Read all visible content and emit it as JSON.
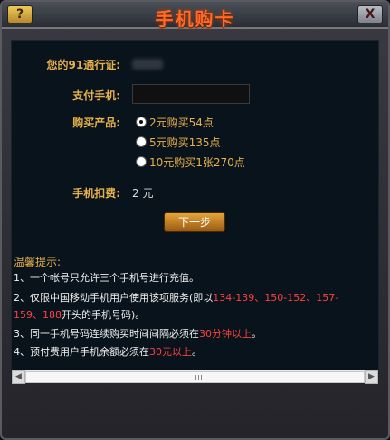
{
  "window": {
    "title": "手机购卡",
    "help_label": "?",
    "close_label": "X"
  },
  "form": {
    "account_label": "您的91通行证:",
    "phone_label": "支付手机:",
    "phone_value": "",
    "product_label": "购买产品:",
    "products": [
      {
        "label": "2元购买54点",
        "checked": true
      },
      {
        "label": "5元购买135点",
        "checked": false
      },
      {
        "label": "10元购买1张270点",
        "checked": false
      }
    ],
    "fee_label": "手机扣费:",
    "fee_value": "2 元",
    "next_button": "下一步"
  },
  "tips": {
    "title": "温馨提示:",
    "line1": "1、一个帐号只允许三个手机号进行充值。",
    "line2_prefix": "2、仅限中国移动手机用户使用该项服务(即以",
    "line2_ranges1": "134-139、150-152、157-",
    "line2_ranges2": "159、188",
    "line2_suffix": "开头的手机号码)。",
    "line3_prefix": "3、同一手机号码连续购买时间间隔必须在",
    "line3_highlight": "30分钟以上",
    "line3_suffix": "。",
    "line4_prefix": "4、预付费用户手机余额必须在",
    "line4_highlight": "30元以上",
    "line4_suffix": "。"
  },
  "scrollbar": {
    "left_icon": "arrow-left-icon",
    "right_icon": "arrow-right-icon"
  }
}
